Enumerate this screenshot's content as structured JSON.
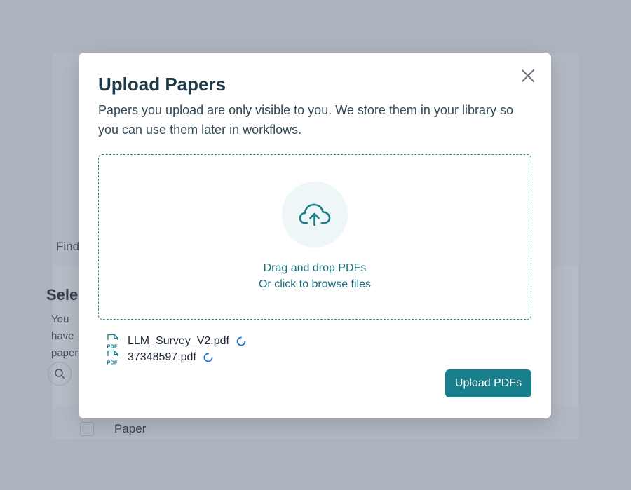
{
  "background": {
    "tab_label": "Find",
    "section_title": "Select",
    "section_desc": "You have papers.",
    "column_paper": "Paper"
  },
  "modal": {
    "title": "Upload Papers",
    "description": "Papers you upload are only visible to you. We store them in your library so you can use them later in workflows.",
    "dropzone_line1": "Drag and drop PDFs",
    "dropzone_line2": "Or click to browse files",
    "files": [
      {
        "name": "LLM_Survey_V2.pdf",
        "status": "uploading"
      },
      {
        "name": "37348597.pdf",
        "status": "uploading"
      }
    ],
    "upload_button_label": "Upload PDFs",
    "icons": {
      "close": "close-icon",
      "upload": "cloud-upload-icon",
      "file": "pdf-file-icon",
      "spinner": "loading-spinner-icon"
    },
    "colors": {
      "accent": "#17808c",
      "overlay": "#adb4bf",
      "spinner": "#1e73d6"
    }
  }
}
